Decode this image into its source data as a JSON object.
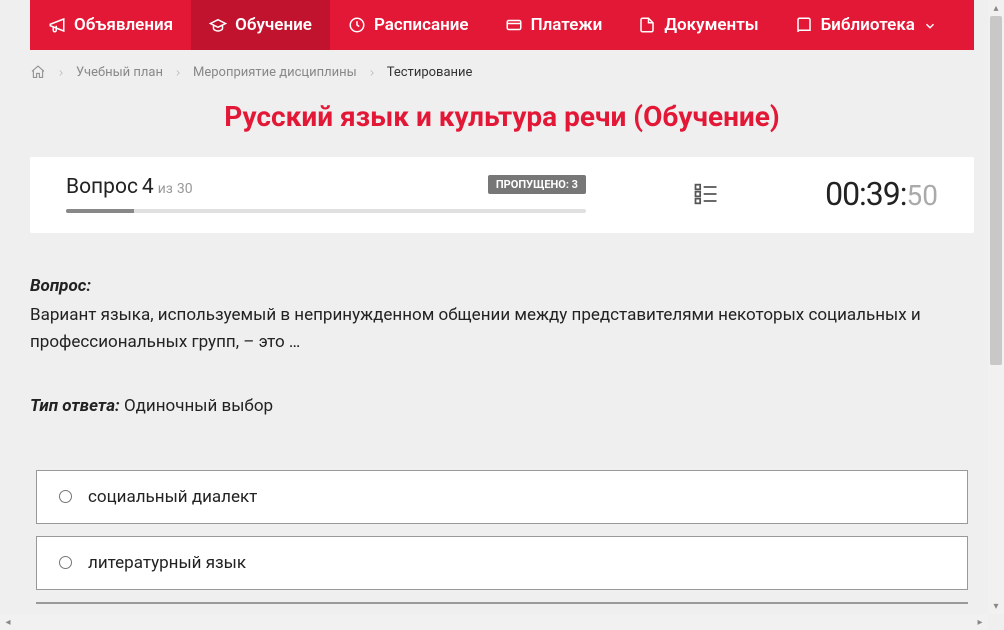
{
  "nav": {
    "items": [
      {
        "label": "Объявления",
        "active": false,
        "icon": "megaphone"
      },
      {
        "label": "Обучение",
        "active": true,
        "icon": "graduation"
      },
      {
        "label": "Расписание",
        "active": false,
        "icon": "clock"
      },
      {
        "label": "Платежи",
        "active": false,
        "icon": "card"
      },
      {
        "label": "Документы",
        "active": false,
        "icon": "doc"
      },
      {
        "label": "Библиотека",
        "active": false,
        "icon": "book",
        "dropdown": true
      }
    ]
  },
  "breadcrumbs": {
    "items": [
      {
        "label": "Учебный план",
        "current": false
      },
      {
        "label": "Мероприятие дисциплины",
        "current": false
      },
      {
        "label": "Тестирование",
        "current": true
      }
    ]
  },
  "page_title": "Русский язык и культура речи (Обучение)",
  "status": {
    "question_prefix": "Вопрос",
    "question_num": "4",
    "of_word": "из",
    "question_total": "30",
    "skipped_label": "ПРОПУЩЕНО: 3",
    "progress_percent": 13,
    "timer_main": "00:39:",
    "timer_sec": "50"
  },
  "question": {
    "label": "Вопрос:",
    "text": "Вариант языка, используемый в непринужденном общении между представителями некоторых социальных и профессиональных групп, – это …",
    "answer_type_label": "Тип ответа:",
    "answer_type": "Одиночный выбор"
  },
  "options": [
    {
      "label": "социальный диалект"
    },
    {
      "label": "литературный язык"
    }
  ]
}
